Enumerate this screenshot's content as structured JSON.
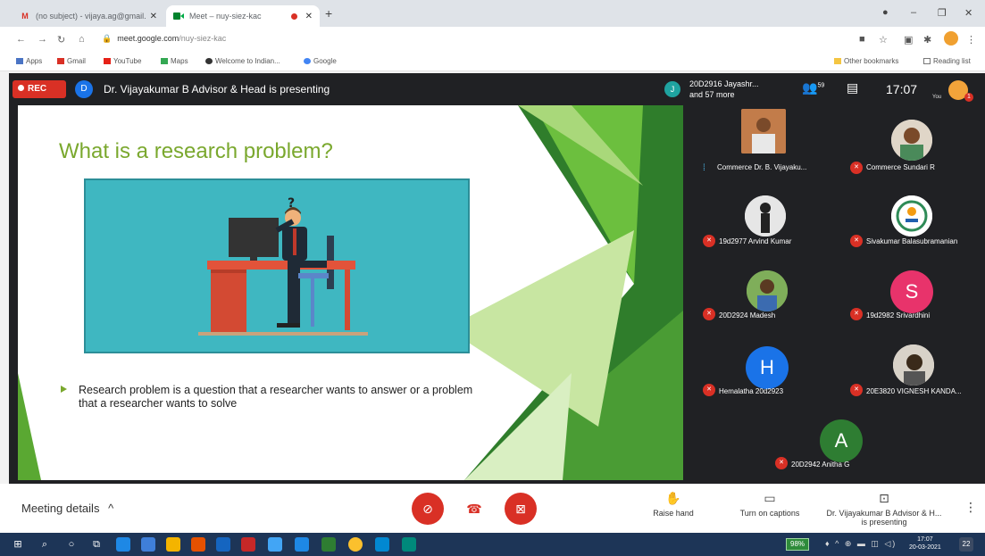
{
  "browser": {
    "tabs": [
      {
        "label": "(no subject) - vijaya.ag@gmail.c",
        "icon": "gmail-icon"
      },
      {
        "label": "Meet – nuy-siez-kac",
        "icon": "meet-icon"
      }
    ],
    "url_domain": "meet.google.com",
    "url_path": "/nuy-siez-kac",
    "bookmarks": [
      "Apps",
      "Gmail",
      "YouTube",
      "Maps",
      "Welcome to Indian...",
      "Google"
    ],
    "other_bookmarks": "Other bookmarks",
    "reading_list": "Reading list"
  },
  "meet": {
    "rec_label": "REC",
    "presenter_initial": "D",
    "presenter_text": "Dr. Vijayakumar B Advisor & Head is presenting",
    "joined_initial": "J",
    "joined_line1": "20D2916 Jayashr...",
    "joined_line2": "and 57 more",
    "people_count": "59",
    "time": "17:07",
    "you_label": "You",
    "notification_count": "1"
  },
  "slide": {
    "title": "What is a research problem?",
    "bullet": "Research problem is a question that a researcher wants to answer or a problem that a researcher wants to solve",
    "colors": {
      "title": "#7aa82e",
      "illustration_bg": "#3fb7c1",
      "accent_green": "#3e8e2f"
    }
  },
  "participants": [
    {
      "name": "Commerce Dr. B. Vijayaku...",
      "avatar": "photo",
      "speaking": true
    },
    {
      "name": "Commerce Sundari R",
      "avatar": "photo",
      "muted": true
    },
    {
      "name": "19d2977 Arvind Kumar",
      "avatar": "photo",
      "muted": true
    },
    {
      "name": "Sivakumar Balasubramanian",
      "avatar": "logo",
      "muted": true
    },
    {
      "name": "20D2924 Madesh",
      "avatar": "photo",
      "muted": true
    },
    {
      "name": "19d2982 Srivardhini",
      "avatar": "S",
      "muted": true
    },
    {
      "name": "Hemalatha 20d2923",
      "avatar": "H",
      "muted": true
    },
    {
      "name": "20E3820 VIGNESH KANDA...",
      "avatar": "photo",
      "muted": true
    },
    {
      "name": "20D2942 Anitha G",
      "avatar": "A",
      "muted": true
    }
  ],
  "controls": {
    "meeting_details": "Meeting details",
    "raise_hand": "Raise hand",
    "captions": "Turn on captions",
    "presenting_line1": "Dr. Vijayakumar B Advisor & H...",
    "presenting_line2": "is presenting"
  },
  "taskbar": {
    "battery": "98%",
    "time": "17:07",
    "date": "20-03-2021",
    "notif_count": "22"
  }
}
